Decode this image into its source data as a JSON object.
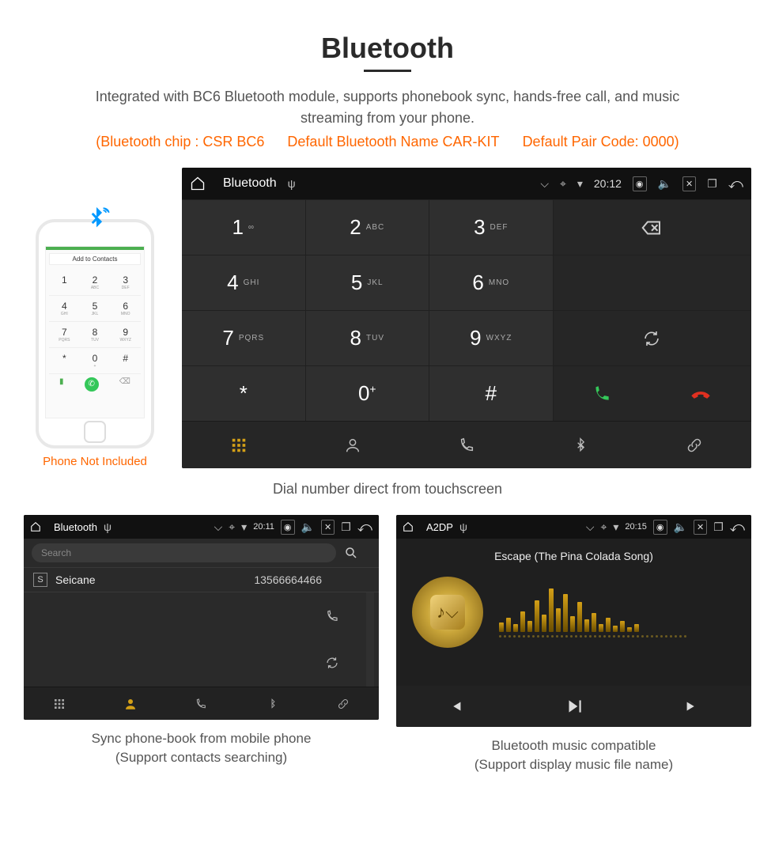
{
  "heading": "Bluetooth",
  "subtitle": "Integrated with BC6 Bluetooth module, supports phonebook sync, hands-free call, and music streaming from your phone.",
  "specs": {
    "chip": "(Bluetooth chip : CSR BC6",
    "name": "Default Bluetooth Name CAR-KIT",
    "code": "Default Pair Code: 0000)"
  },
  "phone": {
    "add_contacts": "Add to Contacts",
    "caption": "Phone Not Included",
    "keys": [
      {
        "d": "1",
        "s": ""
      },
      {
        "d": "2",
        "s": "ABC"
      },
      {
        "d": "3",
        "s": "DEF"
      },
      {
        "d": "4",
        "s": "GHI"
      },
      {
        "d": "5",
        "s": "JKL"
      },
      {
        "d": "6",
        "s": "MNO"
      },
      {
        "d": "7",
        "s": "PQRS"
      },
      {
        "d": "8",
        "s": "TUV"
      },
      {
        "d": "9",
        "s": "WXYZ"
      },
      {
        "d": "*",
        "s": ""
      },
      {
        "d": "0",
        "s": "+"
      },
      {
        "d": "#",
        "s": ""
      }
    ]
  },
  "dialer": {
    "status": {
      "title": "Bluetooth",
      "time": "20:12"
    },
    "keys": [
      {
        "d": "1",
        "s": "∞"
      },
      {
        "d": "2",
        "s": "ABC"
      },
      {
        "d": "3",
        "s": "DEF"
      },
      {
        "d": "4",
        "s": "GHI"
      },
      {
        "d": "5",
        "s": "JKL"
      },
      {
        "d": "6",
        "s": "MNO"
      },
      {
        "d": "7",
        "s": "PQRS"
      },
      {
        "d": "8",
        "s": "TUV"
      },
      {
        "d": "9",
        "s": "WXYZ"
      },
      {
        "d": "*",
        "s": ""
      },
      {
        "d": "0",
        "s": "+",
        "sup": true
      },
      {
        "d": "#",
        "s": ""
      }
    ],
    "caption": "Dial number direct from touchscreen"
  },
  "contacts": {
    "status": {
      "title": "Bluetooth",
      "time": "20:11"
    },
    "search_placeholder": "Search",
    "item": {
      "initial": "S",
      "name": "Seicane",
      "number": "13566664466"
    },
    "caption_l1": "Sync phone-book from mobile phone",
    "caption_l2": "(Support contacts searching)"
  },
  "music": {
    "status": {
      "title": "A2DP",
      "time": "20:15"
    },
    "song": "Escape (The Pina Colada Song)",
    "caption_l1": "Bluetooth music compatible",
    "caption_l2": "(Support display music file name)"
  }
}
